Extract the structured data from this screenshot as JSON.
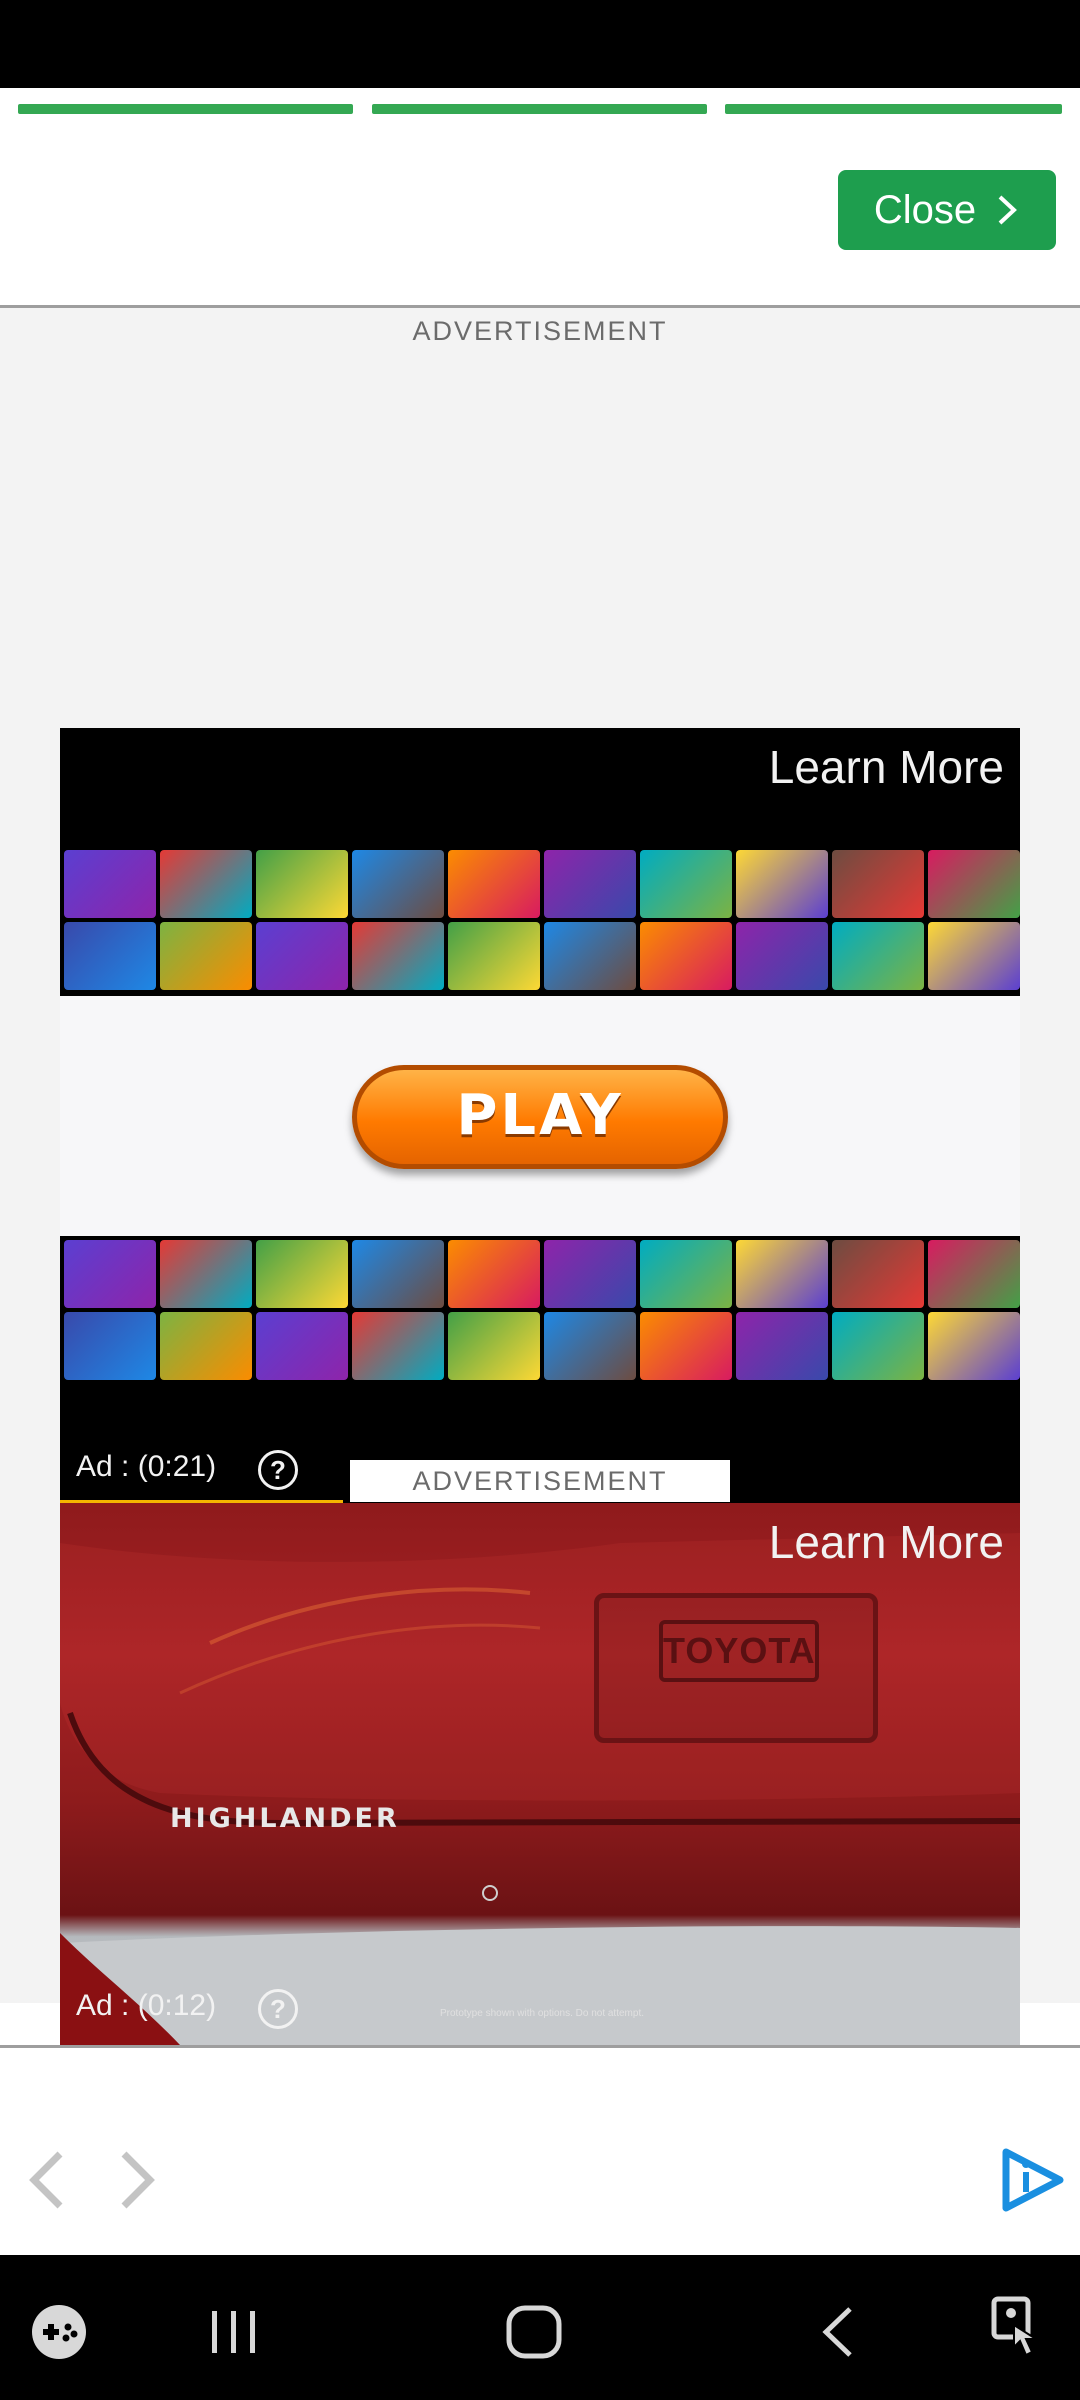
{
  "progress": {
    "segments": 3,
    "color": "#34a853"
  },
  "close_button": {
    "label": "Close",
    "icon": "chevron-right-icon",
    "color": "#1e9e4e"
  },
  "ad_section_1": {
    "label": "ADVERTISEMENT"
  },
  "video_ad_1": {
    "learn_more": "Learn More",
    "play_label": "PLAY",
    "timer": "Ad : (0:21)",
    "help_icon": "question-icon"
  },
  "ad_section_2": {
    "label": "ADVERTISEMENT"
  },
  "video_ad_2": {
    "learn_more": "Learn More",
    "brand_badge": "TOYOTA",
    "model_text": "HIGHLANDER",
    "timer": "Ad : (0:12)",
    "help_icon": "question-icon",
    "disclaimer": "Prototype shown with options. Do not attempt."
  },
  "browser_nav": {
    "back_icon": "chevron-left-icon",
    "forward_icon": "chevron-right-icon",
    "brand_icon": "play-logo-icon",
    "brand_color": "#1a8fe0"
  },
  "system_nav": {
    "game_icon": "gamepad-icon",
    "recents_icon": "recents-icon",
    "home_icon": "home-icon",
    "back_icon": "back-icon",
    "assist_icon": "accessibility-touch-icon"
  }
}
